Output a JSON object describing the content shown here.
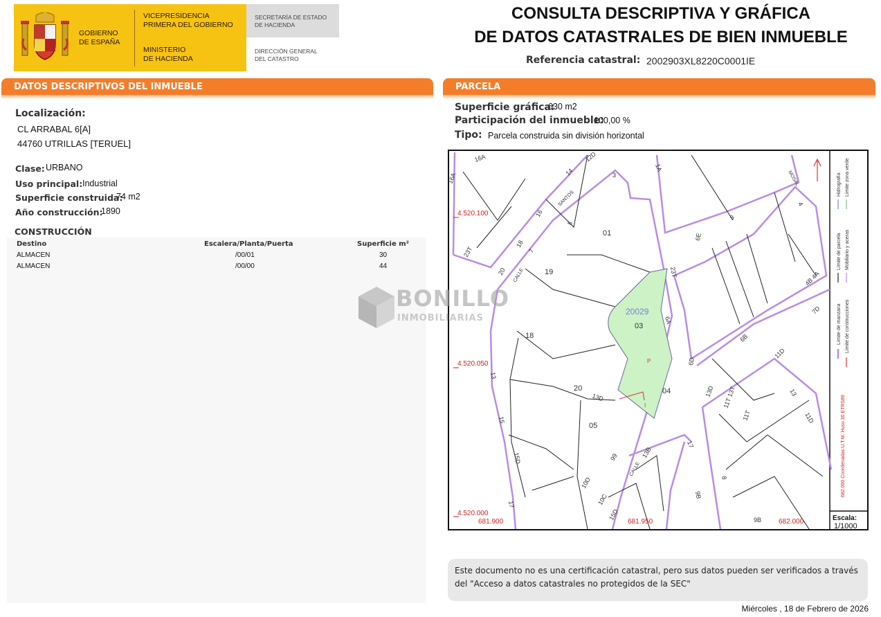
{
  "header": {
    "gov_line1": "GOBIERNO",
    "gov_line2": "DE ESPAÑA",
    "vice_line1": "VICEPRESIDENCIA",
    "vice_line2": "PRIMERA DEL GOBIERNO",
    "min_line1": "MINISTERIO",
    "min_line2": "DE HACIENDA",
    "sec_line1": "SECRETARÍA DE ESTADO",
    "sec_line2": "DE HACIENDA",
    "dir_line1": "DIRECCIÓN GENERAL",
    "dir_line2": "DEL CATASTRO"
  },
  "title": {
    "line1": "CONSULTA DESCRIPTIVA Y GRÁFICA",
    "line2": "DE DATOS CATASTRALES DE BIEN INMUEBLE",
    "ref_label": "Referencia catastral:",
    "ref_value": "2002903XL8220C0001IE"
  },
  "descriptivos": {
    "section_title": "DATOS DESCRIPTIVOS DEL INMUEBLE",
    "localizacion_label": "Localización:",
    "address_line1": "CL ARRABAL 6[A]",
    "address_line2": "44760 UTRILLAS [TERUEL]",
    "clase_label": "Clase:",
    "clase_value": "URBANO",
    "uso_label": "Uso principal:",
    "uso_value": "Industrial",
    "sup_label": "Superficie construida:",
    "sup_value": "74 m2",
    "anio_label": "Año construcción:",
    "anio_value": "1890"
  },
  "construccion": {
    "title": "CONSTRUCCIÓN",
    "headers": [
      "Destino",
      "Escalera/Planta/Puerta",
      "Superficie m²"
    ],
    "rows": [
      {
        "destino": "ALMACEN",
        "epp": "/00/01",
        "sup": "30"
      },
      {
        "destino": "ALMACEN",
        "epp": "/00/00",
        "sup": "44"
      }
    ]
  },
  "parcela": {
    "section_title": "PARCELA",
    "sup_label": "Superficie gráfica:",
    "sup_value": "630 m2",
    "part_label": "Participación del inmueble:",
    "part_value": "100,00 %",
    "tipo_label": "Tipo:",
    "tipo_value": "Parcela construida sin división horizontal"
  },
  "map": {
    "parcel_id": "20029",
    "labels": {
      "p01": "01",
      "p03": "03",
      "p04": "04",
      "p05": "05",
      "p18": "18",
      "p19": "19",
      "p20": "20",
      "y1": "4.520.100",
      "y2": "4.520.050",
      "y3": "4.520.000",
      "x1": "681.900",
      "x2": "681.950",
      "x3": "682.000",
      "s16a": "16A",
      "s12d": "12D",
      "s14": "14",
      "s3": "3",
      "s1a": "1A",
      "s5": "5",
      "s16": "16",
      "s18": "18",
      "s20": "20",
      "s7": "7",
      "s23t": "23T",
      "s6a": "6A",
      "s9": "9",
      "s6d": "6D",
      "s6b": "6B",
      "s11d": "11D",
      "s7d": "7D",
      "s13": "13",
      "s15": "15",
      "s15d": "15D",
      "s17": "17",
      "s13d": "13D",
      "s10d": "10D",
      "s10c": "10C",
      "s99": "99",
      "s13b": "13B",
      "s8": "8",
      "s4": "4",
      "s4b4a": "4B 4A",
      "calle": "CALLE",
      "santos": "SANTOS",
      "mosal": "MOSAL",
      "s2": "2",
      "s13d2": "13D",
      "s11t": "11T",
      "s11t2": "11T 13T",
      "s12": "12",
      "sP": "P",
      "sI": "I",
      "s6e": "6E",
      "s9b": "9B",
      "s15d2": "15D"
    },
    "legend": {
      "l1": "Límite de manzana",
      "l2": "Límite de parcela",
      "l3": "Límite de construcciones",
      "l4": "Mobiliario y aceras",
      "l5": "Hidrografía",
      "l6": "Límite zona verde",
      "coords": "682.000 Coordenadas U.T.M. Huso 30 ETRS89"
    },
    "scale_label": "Escala:",
    "scale_value": "1/1000"
  },
  "note": "Este documento no es una certificación catastral, pero sus datos pueden ser verificados a través del \"Acceso a datos catastrales no protegidos de la SEC\"",
  "date": "Miércoles , 18 de Febrero de 2026",
  "watermark": {
    "line1": "BONILLO",
    "line2": "INMOBILIARIAS"
  },
  "colors": {
    "orange": "#f47d2a",
    "gov_yellow": "#f6c313",
    "block_purple": "#b78ce6",
    "parcel_green": "#ccf2c6",
    "coord_red": "#cc2222"
  }
}
